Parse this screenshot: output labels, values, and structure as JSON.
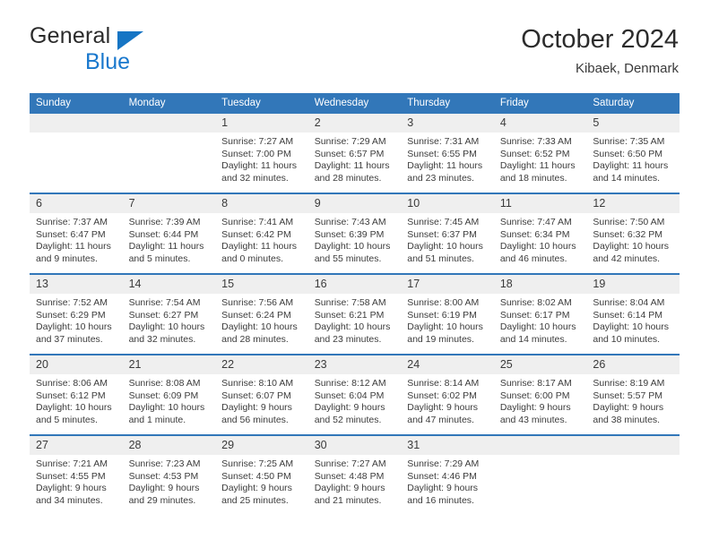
{
  "brand": {
    "name_dark": "General",
    "name_blue": "Blue",
    "triangle_icon": "triangle-icon",
    "accent_color": "#1978cd"
  },
  "header": {
    "title": "October 2024",
    "subtitle": "Kibaek, Denmark"
  },
  "theme": {
    "header_blue": "#3277b9",
    "daynum_bg": "#efefef",
    "text": "#3c3c3c"
  },
  "calendar": {
    "weekday_headers": [
      "Sunday",
      "Monday",
      "Tuesday",
      "Wednesday",
      "Thursday",
      "Friday",
      "Saturday"
    ],
    "labels": {
      "sunrise": "Sunrise:",
      "sunset": "Sunset:",
      "daylight": "Daylight:"
    },
    "weeks": [
      [
        {
          "day": "",
          "blank": true,
          "sunrise": "",
          "sunset": "",
          "daylight_line1": "",
          "daylight_line2": ""
        },
        {
          "day": "",
          "blank": true,
          "sunrise": "",
          "sunset": "",
          "daylight_line1": "",
          "daylight_line2": ""
        },
        {
          "day": "1",
          "blank": false,
          "sunrise": "Sunrise: 7:27 AM",
          "sunset": "Sunset: 7:00 PM",
          "daylight_line1": "Daylight: 11 hours",
          "daylight_line2": "and 32 minutes."
        },
        {
          "day": "2",
          "blank": false,
          "sunrise": "Sunrise: 7:29 AM",
          "sunset": "Sunset: 6:57 PM",
          "daylight_line1": "Daylight: 11 hours",
          "daylight_line2": "and 28 minutes."
        },
        {
          "day": "3",
          "blank": false,
          "sunrise": "Sunrise: 7:31 AM",
          "sunset": "Sunset: 6:55 PM",
          "daylight_line1": "Daylight: 11 hours",
          "daylight_line2": "and 23 minutes."
        },
        {
          "day": "4",
          "blank": false,
          "sunrise": "Sunrise: 7:33 AM",
          "sunset": "Sunset: 6:52 PM",
          "daylight_line1": "Daylight: 11 hours",
          "daylight_line2": "and 18 minutes."
        },
        {
          "day": "5",
          "blank": false,
          "sunrise": "Sunrise: 7:35 AM",
          "sunset": "Sunset: 6:50 PM",
          "daylight_line1": "Daylight: 11 hours",
          "daylight_line2": "and 14 minutes."
        }
      ],
      [
        {
          "day": "6",
          "blank": false,
          "sunrise": "Sunrise: 7:37 AM",
          "sunset": "Sunset: 6:47 PM",
          "daylight_line1": "Daylight: 11 hours",
          "daylight_line2": "and 9 minutes."
        },
        {
          "day": "7",
          "blank": false,
          "sunrise": "Sunrise: 7:39 AM",
          "sunset": "Sunset: 6:44 PM",
          "daylight_line1": "Daylight: 11 hours",
          "daylight_line2": "and 5 minutes."
        },
        {
          "day": "8",
          "blank": false,
          "sunrise": "Sunrise: 7:41 AM",
          "sunset": "Sunset: 6:42 PM",
          "daylight_line1": "Daylight: 11 hours",
          "daylight_line2": "and 0 minutes."
        },
        {
          "day": "9",
          "blank": false,
          "sunrise": "Sunrise: 7:43 AM",
          "sunset": "Sunset: 6:39 PM",
          "daylight_line1": "Daylight: 10 hours",
          "daylight_line2": "and 55 minutes."
        },
        {
          "day": "10",
          "blank": false,
          "sunrise": "Sunrise: 7:45 AM",
          "sunset": "Sunset: 6:37 PM",
          "daylight_line1": "Daylight: 10 hours",
          "daylight_line2": "and 51 minutes."
        },
        {
          "day": "11",
          "blank": false,
          "sunrise": "Sunrise: 7:47 AM",
          "sunset": "Sunset: 6:34 PM",
          "daylight_line1": "Daylight: 10 hours",
          "daylight_line2": "and 46 minutes."
        },
        {
          "day": "12",
          "blank": false,
          "sunrise": "Sunrise: 7:50 AM",
          "sunset": "Sunset: 6:32 PM",
          "daylight_line1": "Daylight: 10 hours",
          "daylight_line2": "and 42 minutes."
        }
      ],
      [
        {
          "day": "13",
          "blank": false,
          "sunrise": "Sunrise: 7:52 AM",
          "sunset": "Sunset: 6:29 PM",
          "daylight_line1": "Daylight: 10 hours",
          "daylight_line2": "and 37 minutes."
        },
        {
          "day": "14",
          "blank": false,
          "sunrise": "Sunrise: 7:54 AM",
          "sunset": "Sunset: 6:27 PM",
          "daylight_line1": "Daylight: 10 hours",
          "daylight_line2": "and 32 minutes."
        },
        {
          "day": "15",
          "blank": false,
          "sunrise": "Sunrise: 7:56 AM",
          "sunset": "Sunset: 6:24 PM",
          "daylight_line1": "Daylight: 10 hours",
          "daylight_line2": "and 28 minutes."
        },
        {
          "day": "16",
          "blank": false,
          "sunrise": "Sunrise: 7:58 AM",
          "sunset": "Sunset: 6:21 PM",
          "daylight_line1": "Daylight: 10 hours",
          "daylight_line2": "and 23 minutes."
        },
        {
          "day": "17",
          "blank": false,
          "sunrise": "Sunrise: 8:00 AM",
          "sunset": "Sunset: 6:19 PM",
          "daylight_line1": "Daylight: 10 hours",
          "daylight_line2": "and 19 minutes."
        },
        {
          "day": "18",
          "blank": false,
          "sunrise": "Sunrise: 8:02 AM",
          "sunset": "Sunset: 6:17 PM",
          "daylight_line1": "Daylight: 10 hours",
          "daylight_line2": "and 14 minutes."
        },
        {
          "day": "19",
          "blank": false,
          "sunrise": "Sunrise: 8:04 AM",
          "sunset": "Sunset: 6:14 PM",
          "daylight_line1": "Daylight: 10 hours",
          "daylight_line2": "and 10 minutes."
        }
      ],
      [
        {
          "day": "20",
          "blank": false,
          "sunrise": "Sunrise: 8:06 AM",
          "sunset": "Sunset: 6:12 PM",
          "daylight_line1": "Daylight: 10 hours",
          "daylight_line2": "and 5 minutes."
        },
        {
          "day": "21",
          "blank": false,
          "sunrise": "Sunrise: 8:08 AM",
          "sunset": "Sunset: 6:09 PM",
          "daylight_line1": "Daylight: 10 hours",
          "daylight_line2": "and 1 minute."
        },
        {
          "day": "22",
          "blank": false,
          "sunrise": "Sunrise: 8:10 AM",
          "sunset": "Sunset: 6:07 PM",
          "daylight_line1": "Daylight: 9 hours",
          "daylight_line2": "and 56 minutes."
        },
        {
          "day": "23",
          "blank": false,
          "sunrise": "Sunrise: 8:12 AM",
          "sunset": "Sunset: 6:04 PM",
          "daylight_line1": "Daylight: 9 hours",
          "daylight_line2": "and 52 minutes."
        },
        {
          "day": "24",
          "blank": false,
          "sunrise": "Sunrise: 8:14 AM",
          "sunset": "Sunset: 6:02 PM",
          "daylight_line1": "Daylight: 9 hours",
          "daylight_line2": "and 47 minutes."
        },
        {
          "day": "25",
          "blank": false,
          "sunrise": "Sunrise: 8:17 AM",
          "sunset": "Sunset: 6:00 PM",
          "daylight_line1": "Daylight: 9 hours",
          "daylight_line2": "and 43 minutes."
        },
        {
          "day": "26",
          "blank": false,
          "sunrise": "Sunrise: 8:19 AM",
          "sunset": "Sunset: 5:57 PM",
          "daylight_line1": "Daylight: 9 hours",
          "daylight_line2": "and 38 minutes."
        }
      ],
      [
        {
          "day": "27",
          "blank": false,
          "sunrise": "Sunrise: 7:21 AM",
          "sunset": "Sunset: 4:55 PM",
          "daylight_line1": "Daylight: 9 hours",
          "daylight_line2": "and 34 minutes."
        },
        {
          "day": "28",
          "blank": false,
          "sunrise": "Sunrise: 7:23 AM",
          "sunset": "Sunset: 4:53 PM",
          "daylight_line1": "Daylight: 9 hours",
          "daylight_line2": "and 29 minutes."
        },
        {
          "day": "29",
          "blank": false,
          "sunrise": "Sunrise: 7:25 AM",
          "sunset": "Sunset: 4:50 PM",
          "daylight_line1": "Daylight: 9 hours",
          "daylight_line2": "and 25 minutes."
        },
        {
          "day": "30",
          "blank": false,
          "sunrise": "Sunrise: 7:27 AM",
          "sunset": "Sunset: 4:48 PM",
          "daylight_line1": "Daylight: 9 hours",
          "daylight_line2": "and 21 minutes."
        },
        {
          "day": "31",
          "blank": false,
          "sunrise": "Sunrise: 7:29 AM",
          "sunset": "Sunset: 4:46 PM",
          "daylight_line1": "Daylight: 9 hours",
          "daylight_line2": "and 16 minutes."
        },
        {
          "day": "",
          "blank": true,
          "sunrise": "",
          "sunset": "",
          "daylight_line1": "",
          "daylight_line2": ""
        },
        {
          "day": "",
          "blank": true,
          "sunrise": "",
          "sunset": "",
          "daylight_line1": "",
          "daylight_line2": ""
        }
      ]
    ]
  }
}
